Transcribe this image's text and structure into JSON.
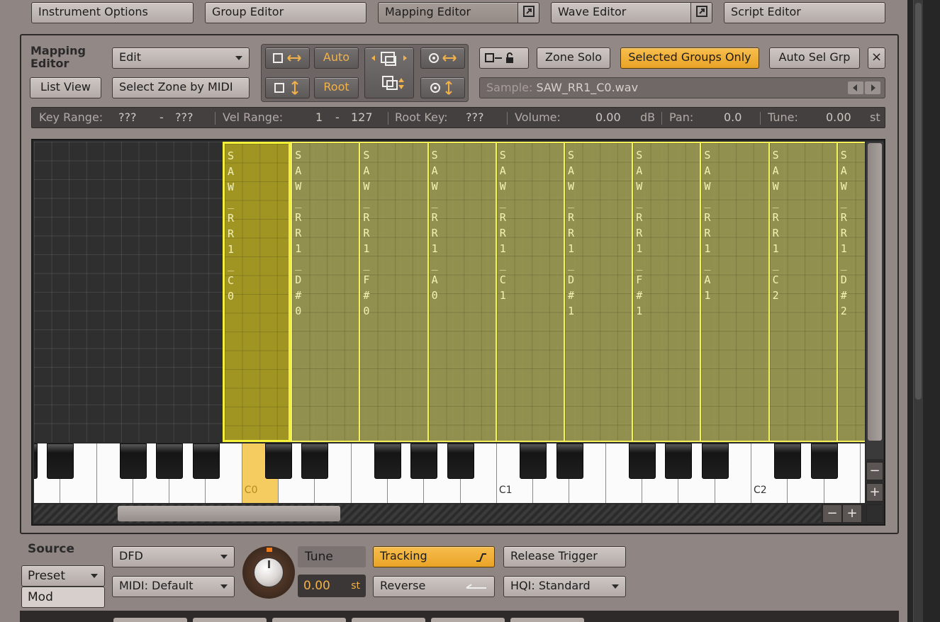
{
  "editor_tabs": [
    {
      "label": "Instrument Options"
    },
    {
      "label": "Group Editor"
    },
    {
      "label": "Mapping Editor"
    },
    {
      "label": "Wave Editor"
    },
    {
      "label": "Script Editor"
    }
  ],
  "mapping": {
    "title_line1": "Mapping",
    "title_line2": "Editor",
    "edit_menu": "Edit",
    "list_view": "List View",
    "select_zone_by_midi": "Select Zone by MIDI",
    "auto": "Auto",
    "root": "Root",
    "zone_solo": "Zone Solo",
    "selected_groups_only": "Selected Groups Only",
    "auto_sel_grp": "Auto Sel Grp",
    "close": "×",
    "sample_label": "Sample:",
    "sample_name": "SAW_RR1_C0.wav"
  },
  "info_bar": {
    "key_range_label": "Key Range:",
    "key_range_low": "???",
    "key_range_dash": "-",
    "key_range_high": "???",
    "vel_range_label": "Vel Range:",
    "vel_low": "1",
    "vel_dash": "-",
    "vel_high": "127",
    "root_key_label": "Root Key:",
    "root_key": "???",
    "volume_label": "Volume:",
    "volume": "0.00",
    "volume_unit": "dB",
    "pan_label": "Pan:",
    "pan": "0.0",
    "tune_label": "Tune:",
    "tune": "0.00",
    "tune_unit": "st"
  },
  "zones": [
    {
      "name": "SAW_RR1_C0",
      "selected": true
    },
    {
      "name": "SAW_RR1_D#0",
      "selected": false
    },
    {
      "name": "SAW_RR1_F#0",
      "selected": false
    },
    {
      "name": "SAW_RR1_A0",
      "selected": false
    },
    {
      "name": "SAW_RR1_C1",
      "selected": false
    },
    {
      "name": "SAW_RR1_D#1",
      "selected": false
    },
    {
      "name": "SAW_RR1_F#1",
      "selected": false
    },
    {
      "name": "SAW_RR1_A1",
      "selected": false
    },
    {
      "name": "SAW_RR1_C2",
      "selected": false
    },
    {
      "name": "SAW_RR1_D#2",
      "selected": false
    }
  ],
  "keyboard": {
    "labels": {
      "c0": "C0",
      "c1": "C1",
      "c2": "C2"
    }
  },
  "zoom": {
    "minus": "−",
    "plus": "+"
  },
  "source": {
    "section_label": "Source",
    "preset_tab": "Preset",
    "mod_tab": "Mod",
    "mode": "DFD",
    "midi": "MIDI: Default",
    "tune_label": "Tune",
    "tune_value": "0.00",
    "tune_unit": "st",
    "tracking": "Tracking",
    "reverse": "Reverse",
    "release_trigger": "Release Trigger",
    "hq": "HQI: Standard"
  },
  "colors": {
    "zone_fill": "#a09e54",
    "zone_selected": "#a09422",
    "zone_border": "#f3f05c",
    "accent_orange": "#f2b24b"
  }
}
